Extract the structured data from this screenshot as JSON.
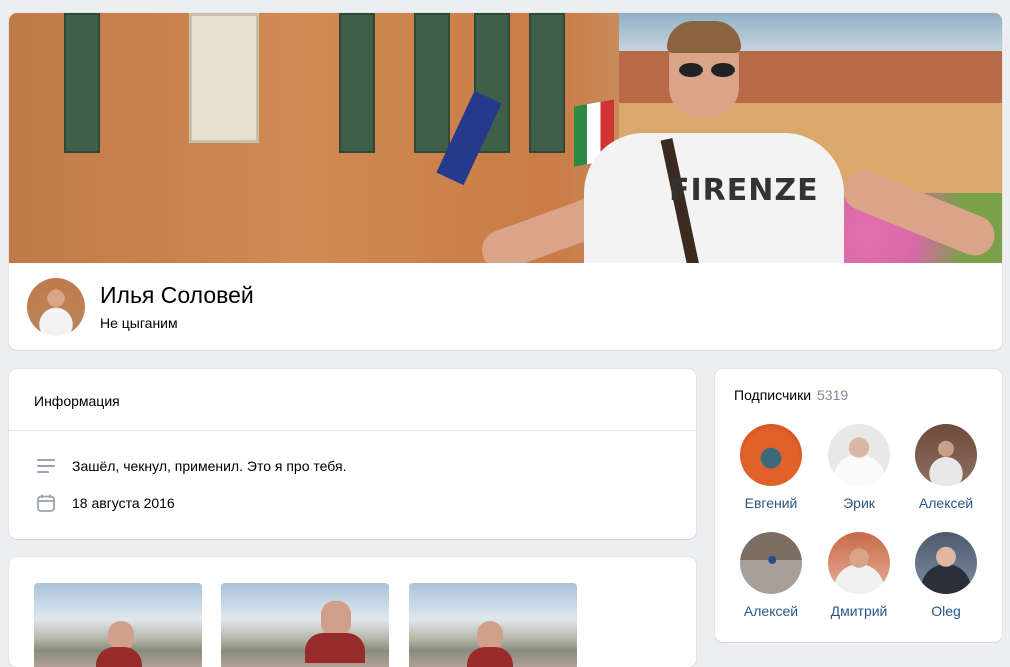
{
  "profile": {
    "name": "Илья Соловей",
    "status": "Не цыганим",
    "cover_shirt_text": "FIRENZE"
  },
  "info": {
    "title": "Информация",
    "rows": [
      {
        "icon": "text-lines-icon",
        "text": "Зашёл, чекнул, применил. Это я про тебя."
      },
      {
        "icon": "calendar-icon",
        "text": "18 августа 2016"
      }
    ]
  },
  "subscribers": {
    "title": "Подписчики",
    "count": "5319",
    "items": [
      {
        "name": "Евгений",
        "avatar_color": "#e0612a"
      },
      {
        "name": "Эрик",
        "avatar_color": "#e8e8e8"
      },
      {
        "name": "Алексей",
        "avatar_color": "#6b4a3a"
      },
      {
        "name": "Алексей",
        "avatar_color": "#8c7a6c"
      },
      {
        "name": "Дмитрий",
        "avatar_color": "#d89a82"
      },
      {
        "name": "Oleg",
        "avatar_color": "#4c5a6e"
      }
    ]
  },
  "colors": {
    "link": "#2a5885",
    "muted": "#818c99",
    "page_bg": "#edeef0",
    "icon": "#99a2ad"
  }
}
